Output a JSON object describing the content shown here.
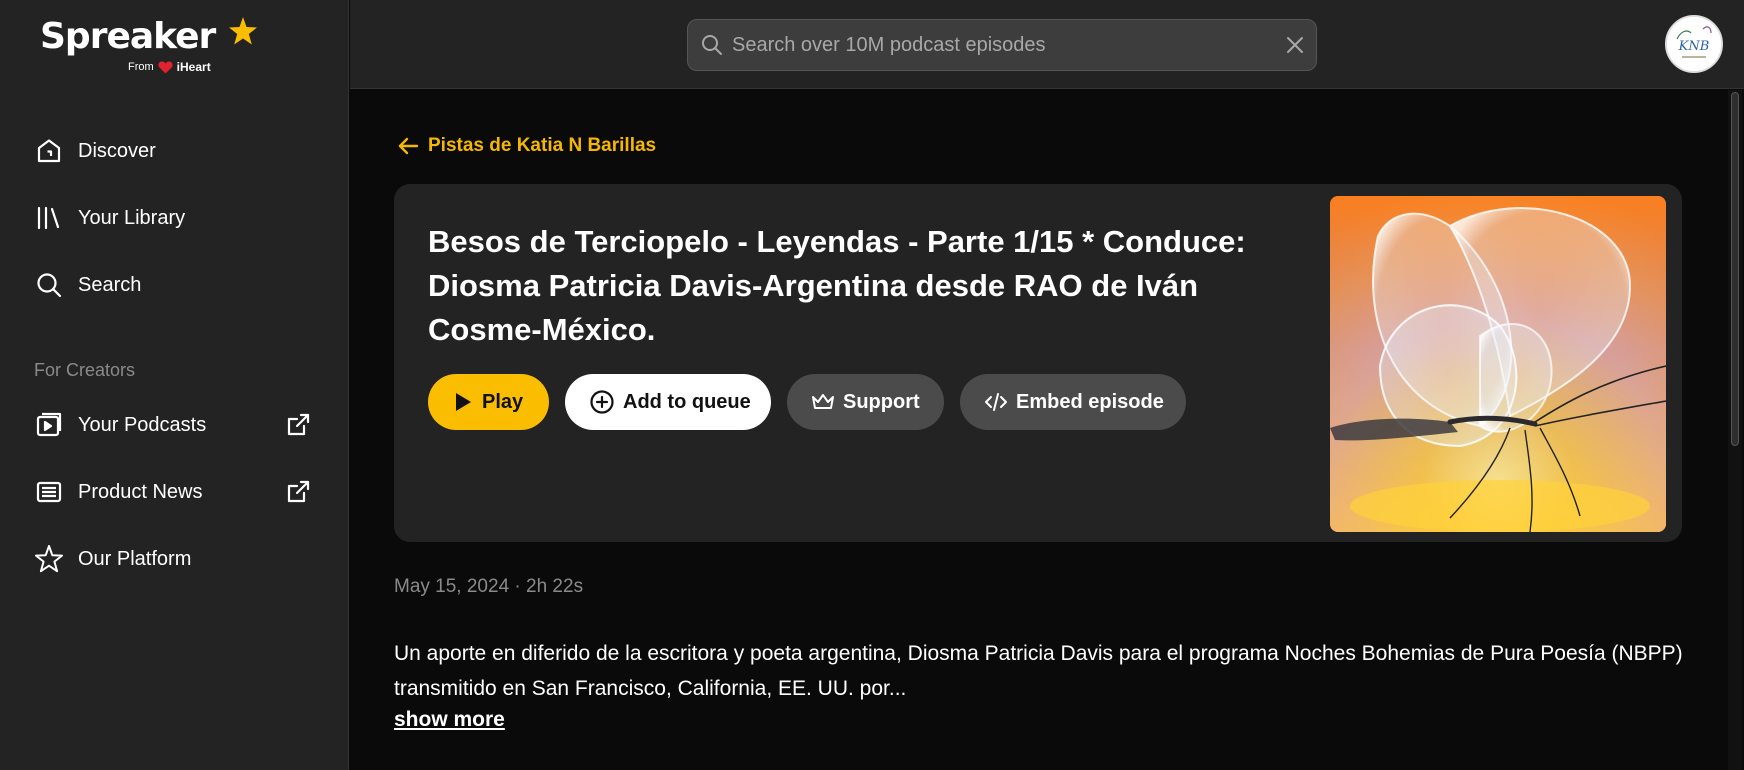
{
  "app": {
    "brand": "Spreaker",
    "brand_from": "From",
    "brand_parent": "iHeart"
  },
  "sidebar": {
    "items": [
      {
        "label": "Discover",
        "icon": "home-icon"
      },
      {
        "label": "Your Library",
        "icon": "library-icon"
      },
      {
        "label": "Search",
        "icon": "search-icon"
      }
    ],
    "section_label": "For Creators",
    "creator_items": [
      {
        "label": "Your Podcasts",
        "icon": "podcast-icon",
        "external": true
      },
      {
        "label": "Product News",
        "icon": "news-icon",
        "external": true
      },
      {
        "label": "Our Platform",
        "icon": "star-icon",
        "external": false
      }
    ]
  },
  "search": {
    "placeholder": "Search over 10M podcast episodes",
    "value": ""
  },
  "avatar": {
    "initials": "KNB"
  },
  "episode": {
    "back_label": "Pistas de Katia N Barillas",
    "title": "Besos de Terciopelo - Leyendas - Parte 1/15 * Conduce: Diosma Patricia Davis-Argentina desde RAO de Iván Cosme-México.",
    "buttons": {
      "play": "Play",
      "queue": "Add to queue",
      "support": "Support",
      "embed": "Embed episode"
    },
    "meta": "May 15, 2024 · 2h 22s",
    "description": "Un aporte en diferido de la escritora y poeta argentina, Diosma Patricia Davis para el programa Noches Bohemias de Pura Poesía (NBPP) transmitido en San Francisco, California, EE. UU. por...",
    "show_more": "show more"
  },
  "colors": {
    "accent": "#fbbd00",
    "sidebar_bg": "#232323",
    "main_bg": "#0a0a0a",
    "card_bg": "#232323"
  }
}
